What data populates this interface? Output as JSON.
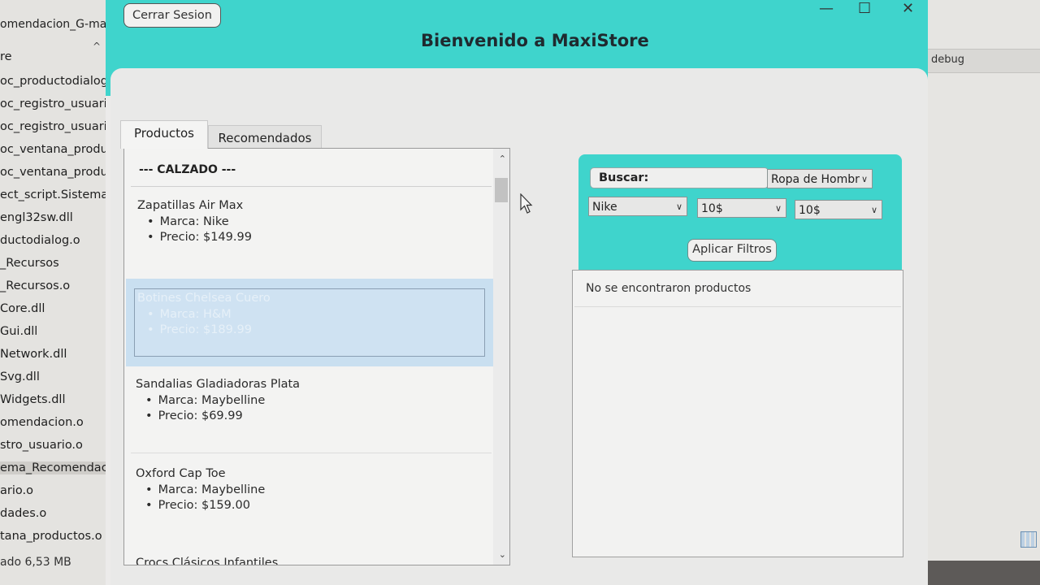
{
  "background_explorer": {
    "title": "omendacion_G-ma",
    "files": [
      "re",
      "oc_productodialog.",
      "oc_registro_usuario",
      "oc_registro_usuario",
      "oc_ventana_produc",
      "oc_ventana_produc",
      "ect_script.Sistema_",
      "engl32sw.dll",
      "ductodialog.o",
      "_Recursos",
      "_Recursos.o",
      "Core.dll",
      "Gui.dll",
      "Network.dll",
      "Svg.dll",
      "Widgets.dll",
      "omendacion.o",
      "stro_usuario.o",
      "ema_Recomendac",
      "ario.o",
      "dades.o",
      "tana_productos.o"
    ],
    "status": "ado  6,53 MB",
    "right_label": "debug"
  },
  "window": {
    "logout_label": "Cerrar Sesion",
    "title": "Bienvenido a MaxiStore",
    "controls": {
      "minimize": "—",
      "maximize": "☐",
      "close": "✕"
    }
  },
  "tabs": [
    {
      "label": "Productos",
      "active": true
    },
    {
      "label": "Recomendados",
      "active": false
    }
  ],
  "product_list": {
    "category_header": "--- CALZADO ---",
    "items": [
      {
        "name": "Zapatillas Air Max",
        "brand": "Marca: Nike",
        "price": "Precio: $149.99"
      },
      {
        "name": "Botines Chelsea Cuero",
        "brand": "Marca: H&M",
        "price": "Precio: $189.99",
        "selected": true
      },
      {
        "name": "Sandalias Gladiadoras Plata",
        "brand": "Marca: Maybelline",
        "price": "Precio: $69.99"
      },
      {
        "name": "Oxford Cap Toe",
        "brand": "Marca: Maybelline",
        "price": "Precio: $159.00"
      },
      {
        "name": "Crocs Clásicos Infantiles"
      }
    ]
  },
  "filters": {
    "search_label": "Buscar:",
    "category_selected": "Ropa de Hombr",
    "brand_selected": "Nike",
    "price_min_selected": "10$",
    "price_max_selected": "10$",
    "apply_label": "Aplicar Filtros"
  },
  "results": {
    "empty_message": "No se encontraron productos"
  },
  "colors": {
    "accent": "#3fd4cc",
    "selection": "#c9dff0"
  },
  "icons": [
    "minimize-icon",
    "maximize-icon",
    "close-icon",
    "chevron-down-icon",
    "chevron-up-icon",
    "mouse-cursor-icon"
  ]
}
